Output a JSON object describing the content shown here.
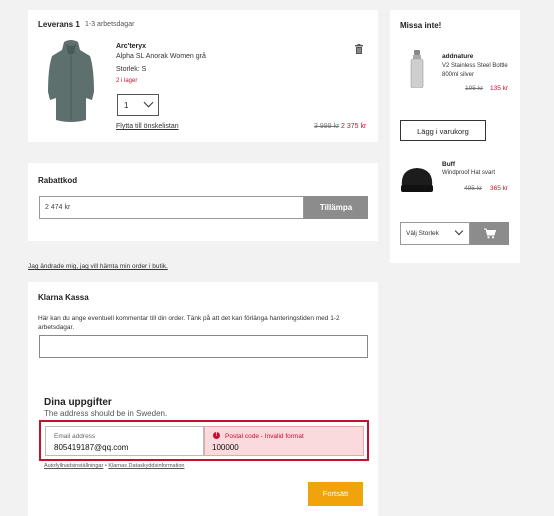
{
  "delivery": {
    "title": "Leverans 1",
    "eta": "1-3 arbetsdagar",
    "product": {
      "brand": "Arc'teryx",
      "name": "Alpha SL Anorak Women grå",
      "size": "Storlek: S",
      "stock": "2 i lager",
      "qty": "1",
      "wishlist": "Flytta till önskelistan",
      "old_price": "3 999 kr",
      "price": "2 375 kr"
    }
  },
  "discount": {
    "title": "Rabattkod",
    "value": "2 474 kr",
    "apply": "Tillämpa"
  },
  "store_pickup": "Jag ändrade mig, jag vill hämta min order i butik.",
  "klarna": {
    "title": "Klarna Kassa",
    "comment_hint": "Här kan du ange eventuell kommentar till din order. Tänk på att det kan förlänga hanteringstiden med 1-2 arbetsdagar.",
    "comment_value": "",
    "details_title": "Dina uppgifter",
    "details_sub": "The address should be in Sweden.",
    "email_label": "Email address",
    "email_value": "805419187@qq.com",
    "postal_label": "Postal code - Invalid format",
    "postal_value": "100000",
    "footer_link_1": "Autofyllnadsinställningar",
    "footer_sep": "•",
    "footer_link_2": "Klarnas Dataskyddsinformation",
    "continue": "Fortsätt"
  },
  "sidebar": {
    "title": "Missa inte!",
    "item1": {
      "brand": "addnature",
      "name": "V2 Stainless Steel Bottle 800ml silver",
      "old_price": "195 kr",
      "price": "135 kr",
      "add": "Lägg i varukorg"
    },
    "item2": {
      "brand": "Buff",
      "name": "Windproof Hat svart",
      "old_price": "495 kr",
      "price": "365 kr",
      "size_select": "Välj Storlek"
    }
  },
  "colors": {
    "accent": "#f0a30a",
    "error": "#c8102e",
    "button_grey": "#8c8c8c"
  }
}
